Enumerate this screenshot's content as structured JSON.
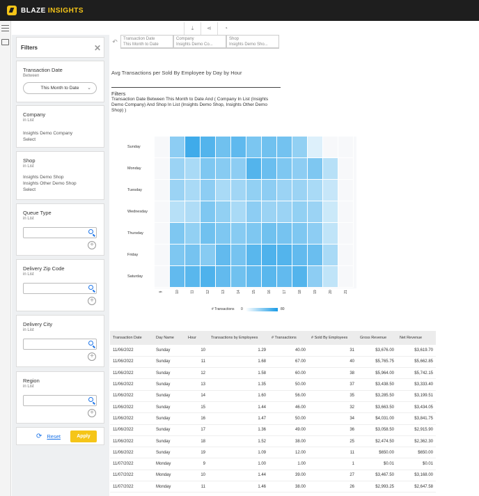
{
  "brand": {
    "part1": "BLAZE",
    "part2": "INSIGHTS"
  },
  "filters_panel": {
    "title": "Filters",
    "transaction_date": {
      "title": "Transaction Date",
      "sub": "Between",
      "value": "This Month to Date"
    },
    "company": {
      "title": "Company",
      "sub": "in List",
      "values": [
        "Insights Demo Company",
        "Select"
      ]
    },
    "shop": {
      "title": "Shop",
      "sub": "in List",
      "values": [
        "Insights Demo Shop",
        "Insights Other Demo Shop",
        "Select"
      ]
    },
    "queue_type": {
      "title": "Queue Type",
      "sub": "in List"
    },
    "delivery_zip": {
      "title": "Delivery Zip Code",
      "sub": "in List"
    },
    "delivery_city": {
      "title": "Delivery City",
      "sub": "in List"
    },
    "region": {
      "title": "Region",
      "sub": "in List"
    },
    "reset_label": "Reset",
    "apply_label": "Apply"
  },
  "tabs": [
    {
      "line1": "Transaction Date",
      "line2": "This Month to Date"
    },
    {
      "line1": "Company",
      "line2": "Insights Demo Co..."
    },
    {
      "line1": "Shop",
      "line2": "Insights Demo Sho..."
    }
  ],
  "report": {
    "title": "Avg Transactions per Sold By Employee by Day by Hour",
    "filters_label": "Filters",
    "filters_text": "Transaction Date Between This Month to Date And ( Company In List (Insights Demo Company) And Shop In List (Insights Demo Shop, Insights Other Demo Shop) )"
  },
  "chart_data": {
    "type": "heatmap",
    "rows": [
      "Sunday",
      "Monday",
      "Tuesday",
      "Wednesday",
      "Thursday",
      "Friday",
      "Saturday"
    ],
    "columns": [
      "9",
      "10",
      "11",
      "12",
      "13",
      "14",
      "15",
      "16",
      "17",
      "18",
      "19",
      "20",
      "21"
    ],
    "values": [
      [
        null,
        40,
        67,
        60,
        50,
        56,
        46,
        50,
        49,
        38,
        12,
        null,
        null
      ],
      [
        null,
        35,
        30,
        45,
        42,
        40,
        60,
        52,
        45,
        40,
        45,
        25,
        null
      ],
      [
        null,
        35,
        30,
        40,
        30,
        33,
        38,
        40,
        35,
        35,
        30,
        20,
        null
      ],
      [
        null,
        25,
        28,
        45,
        38,
        30,
        40,
        35,
        35,
        38,
        35,
        18,
        null
      ],
      [
        null,
        45,
        38,
        50,
        45,
        42,
        45,
        50,
        48,
        45,
        40,
        22,
        null
      ],
      [
        null,
        45,
        48,
        42,
        55,
        48,
        58,
        62,
        60,
        55,
        52,
        30,
        null
      ],
      [
        null,
        55,
        58,
        62,
        55,
        50,
        55,
        58,
        55,
        60,
        40,
        22,
        null
      ]
    ],
    "legend_label": "# Transactions",
    "legend_min": "0",
    "legend_max": "80",
    "color": "#1a9be6"
  },
  "table": {
    "headers": [
      "Transaction Date",
      "Day Name",
      "Hour",
      "Transactions by Employees",
      "# Transactions",
      "# Sold By Employees",
      "Gross Revenue",
      "Net Revenue"
    ],
    "rows": [
      [
        "11/06/2022",
        "Sunday",
        "10",
        "1.29",
        "40.00",
        "31",
        "$3,676.00",
        "$3,619.70"
      ],
      [
        "11/06/2022",
        "Sunday",
        "11",
        "1.68",
        "67.00",
        "40",
        "$5,765.75",
        "$5,662.85"
      ],
      [
        "11/06/2022",
        "Sunday",
        "12",
        "1.58",
        "60.00",
        "38",
        "$5,964.00",
        "$5,742.15"
      ],
      [
        "11/06/2022",
        "Sunday",
        "13",
        "1.35",
        "50.00",
        "37",
        "$3,438.50",
        "$3,333.40"
      ],
      [
        "11/06/2022",
        "Sunday",
        "14",
        "1.60",
        "56.00",
        "35",
        "$3,285.50",
        "$3,199.51"
      ],
      [
        "11/06/2022",
        "Sunday",
        "15",
        "1.44",
        "46.00",
        "32",
        "$3,663.50",
        "$3,434.05"
      ],
      [
        "11/06/2022",
        "Sunday",
        "16",
        "1.47",
        "50.00",
        "34",
        "$4,031.00",
        "$3,841.75"
      ],
      [
        "11/06/2022",
        "Sunday",
        "17",
        "1.36",
        "49.00",
        "36",
        "$3,058.50",
        "$2,915.90"
      ],
      [
        "11/06/2022",
        "Sunday",
        "18",
        "1.52",
        "38.00",
        "25",
        "$2,474.50",
        "$2,362.30"
      ],
      [
        "11/06/2022",
        "Sunday",
        "19",
        "1.09",
        "12.00",
        "11",
        "$650.00",
        "$650.00"
      ],
      [
        "11/07/2022",
        "Monday",
        "9",
        "1.00",
        "1.00",
        "1",
        "$0.01",
        "$0.01"
      ],
      [
        "11/07/2022",
        "Monday",
        "10",
        "1.44",
        "39.00",
        "27",
        "$3,467.50",
        "$3,168.00"
      ],
      [
        "11/07/2022",
        "Monday",
        "11",
        "1.46",
        "38.00",
        "26",
        "$2,993.25",
        "$2,647.58"
      ]
    ]
  }
}
